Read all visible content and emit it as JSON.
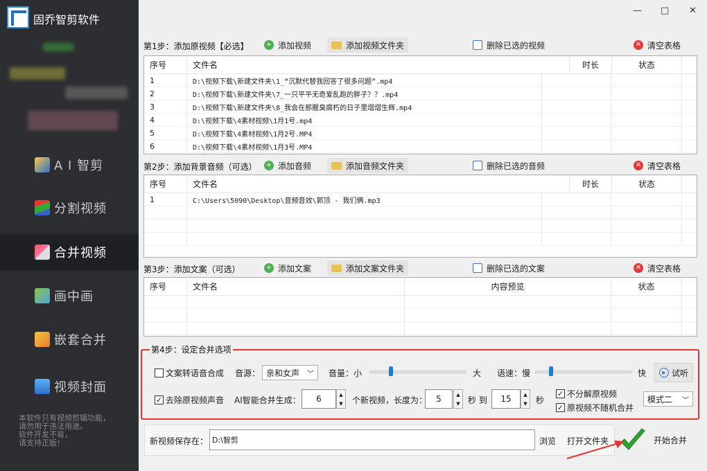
{
  "app": {
    "title": "固乔智剪软件"
  },
  "window": {
    "minimize": "—",
    "maximize": "□",
    "close": "✕"
  },
  "sidebar": {
    "items": [
      {
        "label": "A I 智剪",
        "icon": "ai-icon"
      },
      {
        "label": "分割视频",
        "icon": "split-icon"
      },
      {
        "label": "合并视频",
        "icon": "merge-icon",
        "active": true
      },
      {
        "label": "画中画",
        "icon": "pip-icon"
      },
      {
        "label": "嵌套合并",
        "icon": "nest-icon"
      },
      {
        "label": "视频封面",
        "icon": "cover-icon"
      }
    ],
    "notice": [
      "本软件只有视频剪辑功能，",
      "请勿用于违法用途。",
      "软件开发不易，",
      "请支持正版！"
    ]
  },
  "step1": {
    "label": "第1步：添加原视频【必选】",
    "add": "添加视频",
    "add_folder": "添加视频文件夹",
    "remove": "删除已选的视频",
    "clear": "清空表格",
    "columns": [
      "序号",
      "文件名",
      "时长",
      "状态"
    ],
    "rows": [
      [
        "1",
        "D:\\视频下载\\新建文件夹\\1_“沉默代替我回答了很多问题”.mp4"
      ],
      [
        "2",
        "D:\\视频下载\\新建文件夹\\7_一只平平无奇爱乱跑的胖子？？.mp4"
      ],
      [
        "3",
        "D:\\视频下载\\新建文件夹\\8_我会在那腥臭腐朽的日子里熠熠生辉.mp4"
      ],
      [
        "4",
        "D:\\视频下载\\4素材视频\\1月1号.mp4"
      ],
      [
        "5",
        "D:\\视频下载\\4素材视频\\1月2号.MP4"
      ],
      [
        "6",
        "D:\\视频下载\\4素材视频\\1月3号.MP4"
      ]
    ]
  },
  "step2": {
    "label": "第2步：添加背景音频（可选）",
    "add": "添加音频",
    "add_folder": "添加音频文件夹",
    "remove": "删除已选的音频",
    "clear": "清空表格",
    "columns": [
      "序号",
      "文件名",
      "时长",
      "状态"
    ],
    "rows": [
      [
        "1",
        "C:\\Users\\5090\\Desktop\\音频音效\\郭顶 - 我们俩.mp3"
      ]
    ]
  },
  "step3": {
    "label": "第3步：添加文案（可选）",
    "add": "添加文案",
    "add_folder": "添加文案文件夹",
    "remove": "删除已选的文案",
    "clear": "清空表格",
    "columns": [
      "序号",
      "文件名",
      "内容预览",
      "状态"
    ]
  },
  "step4": {
    "label": "第4步：设定合并选项",
    "tts": "文案转语音合成",
    "tts_checked": false,
    "voice_label": "音源：",
    "voice": "亲和女声",
    "volume_label": "音量：小",
    "volume_max": "大",
    "volume_level": 0.2,
    "speed_label": "语速：慢",
    "speed_max": "快",
    "speed_level": 0.05,
    "audition": "试听",
    "remove_audio": "去除原视频声音",
    "remove_audio_checked": true,
    "gen_label": "AI智能合并生成：",
    "gen_count": "6",
    "gen_unit": "个新视频，长度为：",
    "len_min": "5",
    "to": "秒 到",
    "len_max": "15",
    "sec": "秒",
    "no_split": "不分解原视频",
    "no_split_checked": true,
    "no_random": "原视频不随机合并",
    "no_random_checked": true,
    "mode": "模式二"
  },
  "save": {
    "label": "新视频保存在：",
    "path": "D:\\智剪",
    "browse": "浏览",
    "open": "打开文件夹"
  },
  "start": {
    "label": "开始合并"
  },
  "colors": {
    "highlight": "#e3342f",
    "accent": "#1e7cd6"
  }
}
